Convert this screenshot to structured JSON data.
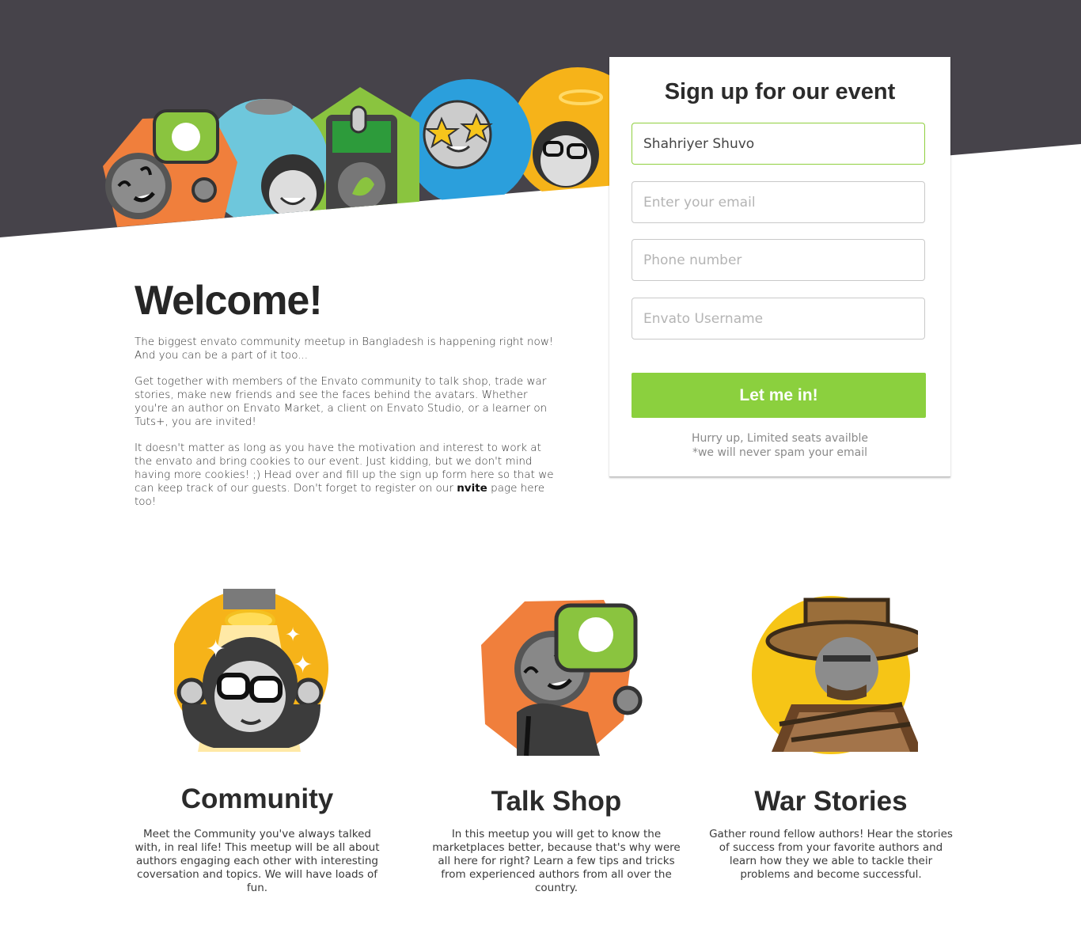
{
  "colors": {
    "dark_band": "#46434a",
    "accent_green": "#8bd03e",
    "accent_orange": "#f07f3c",
    "accent_yellow": "#f6b319"
  },
  "hero": {
    "illustration": "envato-avatars-group"
  },
  "welcome": {
    "title": "Welcome!",
    "para1": "The biggest envato community meetup in Bangladesh is happening right now! And you can be a part of it too...",
    "para2": "Get together with members of the Envato community to talk shop, trade war stories, make new friends and see the faces behind the avatars. Whether you're an author on Envato Market, a client on Envato Studio, or a learner on Tuts+, you are invited!",
    "para3": "It doesn't matter as long as you have the motivation and interest to work at the envato and bring cookies to our event. Just kidding, but we don't mind having more cookies! ;) Head over and fill up the sign up form here so that we can keep track of our guests. Don't forget to register on our ",
    "para3_link": "nvite",
    "para3_end": " page here too!"
  },
  "signup": {
    "title": "Sign up for our event",
    "name_value": "Shahriyer Shuvo",
    "email_placeholder": "Enter your email",
    "phone_placeholder": "Phone number",
    "username_placeholder": "Envato Username",
    "button_label": "Let me in!",
    "note_line1": "Hurry up, Limited seats availble",
    "note_line2": "*we will never spam your email"
  },
  "features": [
    {
      "title": "Community",
      "icon": "community-avatar-icon",
      "text": "Meet the Community you've always talked with, in real life! This meetup will be all about authors engaging each other with interesting coversation and topics. We will have loads of fun."
    },
    {
      "title": "Talk Shop",
      "icon": "talk-shop-avatar-icon",
      "text": "In this meetup you will get to know the marketplaces better, because that's why were all here for right? Learn a few tips and tricks from experienced authors from all over the country."
    },
    {
      "title": "War Stories",
      "icon": "war-stories-avatar-icon",
      "text": "Gather round fellow authors! Hear the stories of success from your favorite authors and learn how they we able to tackle their problems and become successful."
    }
  ]
}
